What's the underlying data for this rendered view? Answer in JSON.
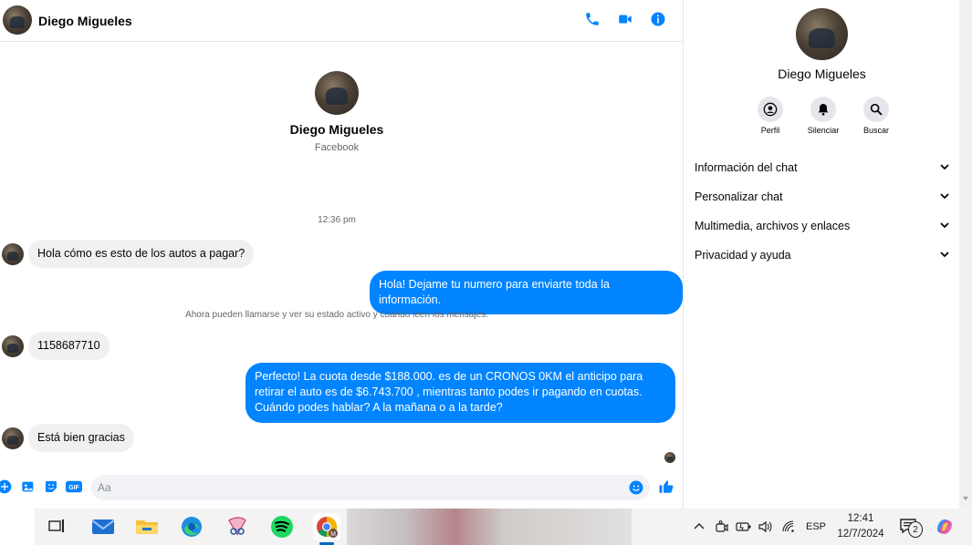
{
  "header": {
    "contact_name": "Diego Migueles",
    "icons": [
      "phone-icon",
      "video-icon",
      "info-icon"
    ],
    "accent_color": "#0084ff"
  },
  "intro": {
    "name": "Diego Migueles",
    "subtitle": "Facebook"
  },
  "conversation": {
    "timestamp": "12:36 pm",
    "notice": "Ahora pueden llamarse y ver su estado activo y cuándo leen los mensajes.",
    "messages": [
      {
        "direction": "incoming",
        "text": "Hola cómo es esto de los autos a pagar?"
      },
      {
        "direction": "outgoing",
        "text": "Hola! Dejame tu numero  para enviarte toda la información."
      },
      {
        "direction": "incoming",
        "text": "1158687710"
      },
      {
        "direction": "outgoing",
        "text": "Perfecto! La cuota desde $188.000. es de un CRONOS 0KM el anticipo para retirar el auto es de $6.743.700 , mientras tanto podes ir pagando en cuotas. Cuándo podes hablar? A la mañana o a la tarde?"
      },
      {
        "direction": "incoming",
        "text": "Está bien gracias"
      }
    ]
  },
  "composer": {
    "placeholder": "Aa",
    "icons": [
      "plus-icon",
      "image-icon",
      "sticker-icon",
      "gif-icon",
      "emoji-icon",
      "like-icon"
    ]
  },
  "panel": {
    "name": "Diego Migueles",
    "actions": [
      {
        "label": "Perfil",
        "icon": "profile-icon"
      },
      {
        "label": "Silenciar",
        "icon": "bell-icon"
      },
      {
        "label": "Buscar",
        "icon": "search-icon"
      }
    ],
    "sections": [
      {
        "label": "Información del chat"
      },
      {
        "label": "Personalizar chat"
      },
      {
        "label": "Multimedia, archivos y enlaces"
      },
      {
        "label": "Privacidad y ayuda"
      }
    ]
  },
  "taskbar": {
    "apps": [
      "task-view-icon",
      "mail-icon",
      "file-explorer-icon",
      "edge-icon",
      "snipping-tool-icon",
      "spotify-icon",
      "chrome-icon"
    ],
    "language": "ESP",
    "time": "12:41",
    "date": "12/7/2024",
    "notification_count": "2"
  }
}
